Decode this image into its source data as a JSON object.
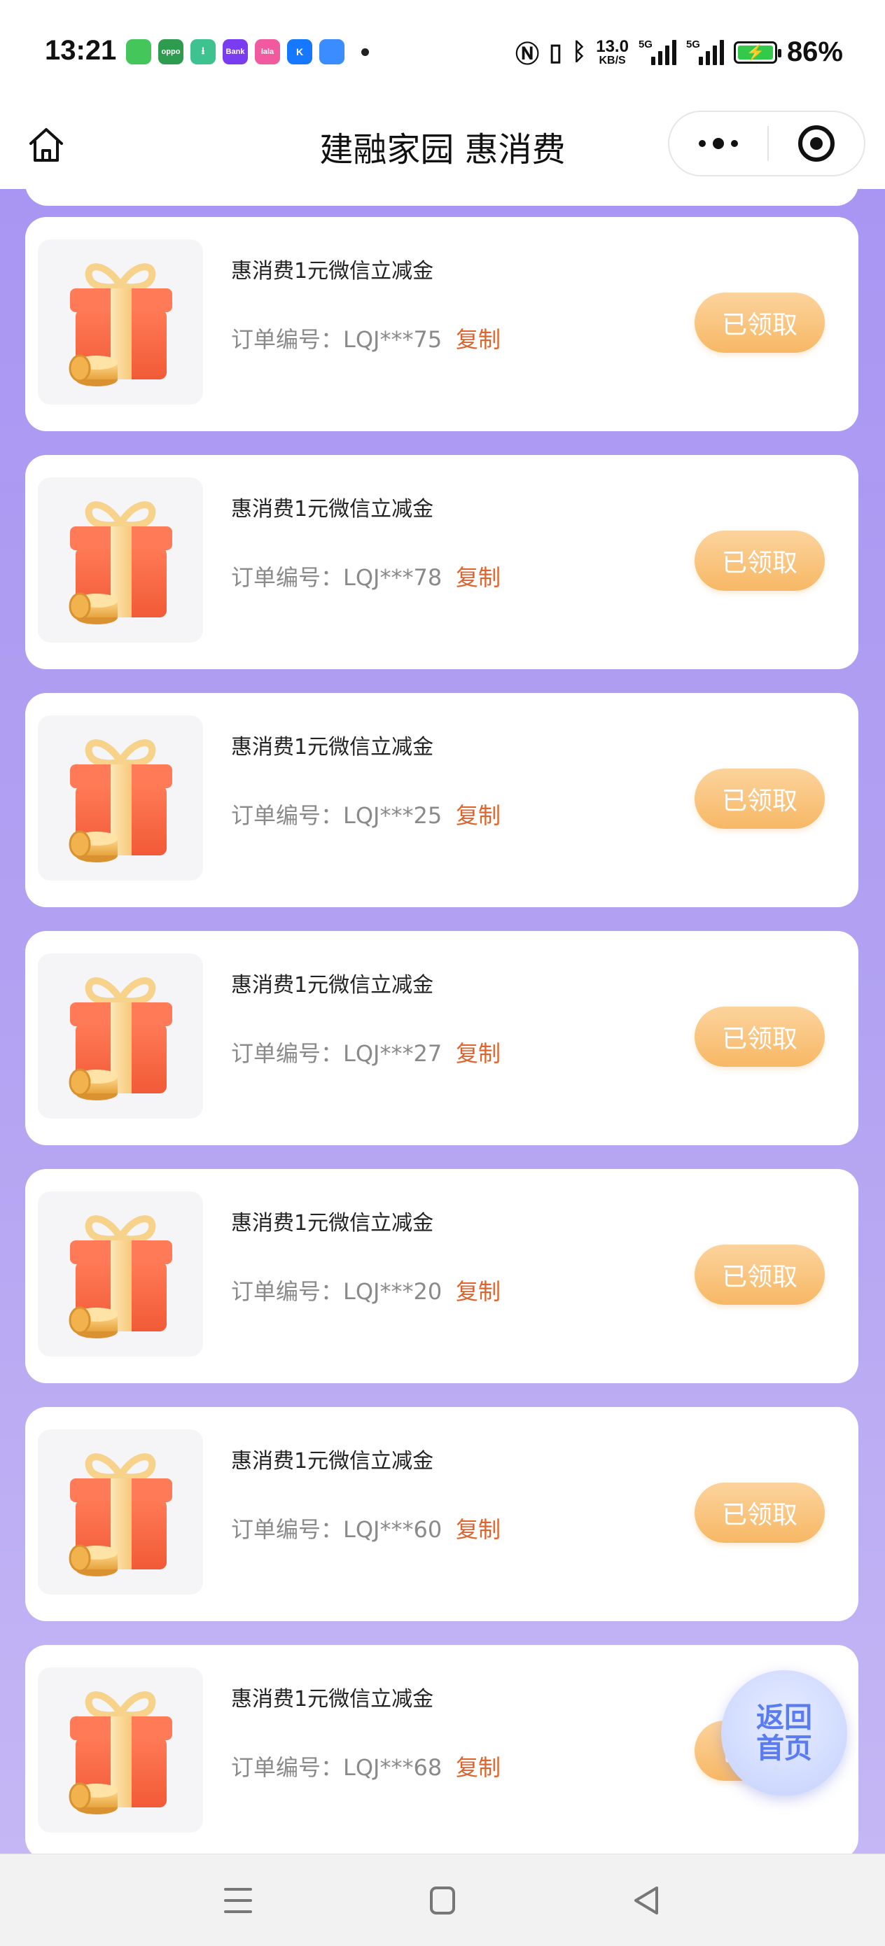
{
  "status_bar": {
    "time": "13:21",
    "apps": [
      {
        "name": "messages-app-icon",
        "color": "#45c65a",
        "glyph": ""
      },
      {
        "name": "oppo-app-icon",
        "color": "#2e9c4e",
        "glyph": "oppo"
      },
      {
        "name": "download-app-icon",
        "color": "#3ec28f",
        "glyph": "⭳"
      },
      {
        "name": "bank-app-icon",
        "color": "#7a3cf0",
        "glyph": "Bank"
      },
      {
        "name": "lala-app-icon",
        "color": "#f25aa0",
        "glyph": "lala"
      },
      {
        "name": "k-app-icon",
        "color": "#1677ff",
        "glyph": "K"
      },
      {
        "name": "browser-app-icon",
        "color": "#3a8cff",
        "glyph": ""
      }
    ],
    "speed_value": "13.0",
    "speed_unit": "KB/S",
    "signal_label_1": "5G",
    "signal_label_2": "5G",
    "battery_percent": "86%",
    "battery_color": "#33c94a"
  },
  "nav": {
    "title": "建融家园 惠消费"
  },
  "cards": [
    {
      "title": "惠消费1元微信立减金",
      "order": "订单编号：LQJ***75",
      "copy": "复制",
      "button": "已领取"
    },
    {
      "title": "惠消费1元微信立减金",
      "order": "订单编号：LQJ***78",
      "copy": "复制",
      "button": "已领取"
    },
    {
      "title": "惠消费1元微信立减金",
      "order": "订单编号：LQJ***25",
      "copy": "复制",
      "button": "已领取"
    },
    {
      "title": "惠消费1元微信立减金",
      "order": "订单编号：LQJ***27",
      "copy": "复制",
      "button": "已领取"
    },
    {
      "title": "惠消费1元微信立减金",
      "order": "订单编号：LQJ***20",
      "copy": "复制",
      "button": "已领取"
    },
    {
      "title": "惠消费1元微信立减金",
      "order": "订单编号：LQJ***60",
      "copy": "复制",
      "button": "已领取"
    },
    {
      "title": "惠消费1元微信立减金",
      "order": "订单编号：LQJ***68",
      "copy": "复制",
      "button": "已领取"
    }
  ],
  "float_button": {
    "line1": "返回",
    "line2": "首页"
  },
  "colors": {
    "accent_copy": "#e0632b",
    "claimed_button": "#f7b865",
    "background_top": "#a996f3",
    "background_bottom": "#c5b7f5",
    "float_text": "#5a7cf0"
  }
}
